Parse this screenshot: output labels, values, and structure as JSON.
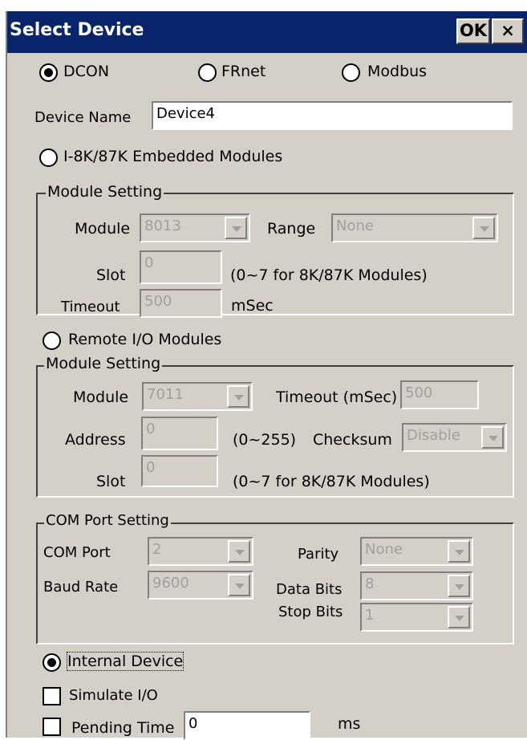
{
  "window": {
    "title": "Select Device",
    "ok_label": "OK",
    "close_label": "×"
  },
  "protocol": {
    "options": [
      "DCON",
      "FRnet",
      "Modbus"
    ],
    "selected": "DCON"
  },
  "device_name": {
    "label": "Device Name",
    "value": "Device4"
  },
  "embedded": {
    "radio_label": "I-8K/87K Embedded Modules",
    "group_title": "Module Setting",
    "module_label": "Module",
    "module_value": "8013",
    "range_label": "Range",
    "range_value": "None",
    "slot_label": "Slot",
    "slot_value": "0",
    "slot_hint": "(0~7 for 8K/87K Modules)",
    "timeout_label": "Timeout",
    "timeout_value": "500",
    "timeout_unit": "mSec"
  },
  "remote": {
    "radio_label": "Remote I/O Modules",
    "group_title": "Module Setting",
    "module_label": "Module",
    "module_value": "7011",
    "timeout_label": "Timeout (mSec)",
    "timeout_value": "500",
    "address_label": "Address",
    "address_value": "0",
    "address_hint": "(0~255)",
    "checksum_label": "Checksum",
    "checksum_value": "Disable",
    "slot_label": "Slot",
    "slot_value": "0",
    "slot_hint": "(0~7 for 8K/87K Modules)"
  },
  "com": {
    "group_title": "COM Port Setting",
    "port_label": "COM Port",
    "port_value": "2",
    "baud_label": "Baud Rate",
    "baud_value": "9600",
    "parity_label": "Parity",
    "parity_value": "None",
    "databits_label": "Data Bits",
    "databits_value": "8",
    "stopbits_label": "Stop Bits",
    "stopbits_value": "1"
  },
  "internal": {
    "radio_label": "Internal Device",
    "selected": true
  },
  "simulate": {
    "label": "Simulate I/O",
    "checked": false
  },
  "pending": {
    "label": "Pending Time",
    "value": "0",
    "unit": "ms",
    "checked": false
  }
}
